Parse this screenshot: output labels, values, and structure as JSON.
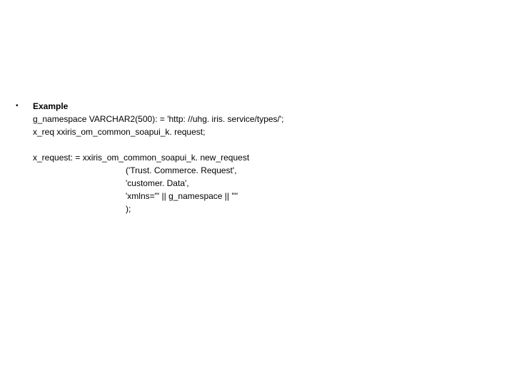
{
  "heading": "Example",
  "line1": "g_namespace VARCHAR2(500): = 'http: //uhg. iris. service/types/';",
  "line2": "x_req    xxiris_om_common_soapui_k. request;",
  "line3": "x_request: = xxiris_om_common_soapui_k. new_request",
  "line4": "('Trust. Commerce. Request',",
  "line5": " 'customer. Data',",
  "line6": " 'xmlns=\"' || g_namespace || '\"'",
  "line7": " );",
  "bullet": "•"
}
